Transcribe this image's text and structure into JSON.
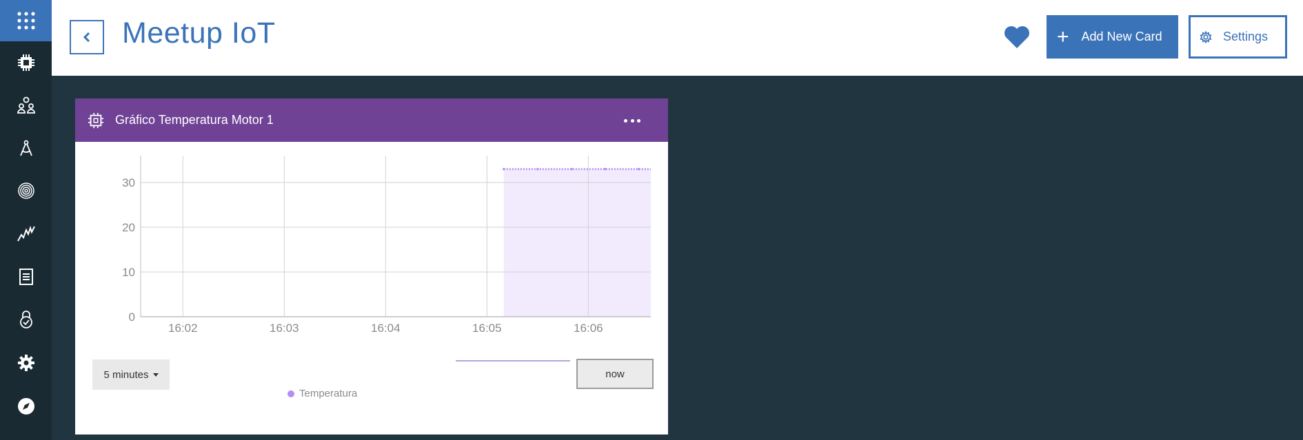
{
  "header": {
    "title": "Meetup IoT",
    "add_card_label": "Add New Card",
    "settings_label": "Settings"
  },
  "rail": {
    "items": [
      "apps-icon",
      "chip-icon",
      "members-icon",
      "compass-draw-icon",
      "fingerprint-icon",
      "analytics-icon",
      "document-icon",
      "security-icon",
      "gear-icon",
      "explore-icon"
    ]
  },
  "card": {
    "title": "Gráfico Temperatura Motor 1",
    "range_label": "5 minutes",
    "now_label": "now"
  },
  "colors": {
    "accent": "#3b73b9",
    "card_header": "#6f4296",
    "series": "#b48ef0",
    "background": "#213540"
  },
  "chart_data": {
    "type": "area",
    "title": "",
    "xlabel": "",
    "ylabel": "",
    "x_ticks": [
      "16:02",
      "16:03",
      "16:04",
      "16:05",
      "16:06"
    ],
    "y_ticks": [
      0,
      10,
      20,
      30
    ],
    "ylim": [
      0,
      36
    ],
    "x": [
      "16:05:10",
      "16:05:30",
      "16:05:50",
      "16:06:10",
      "16:06:30"
    ],
    "series": [
      {
        "name": "Temperatura",
        "values": [
          33,
          33,
          33,
          33,
          33
        ],
        "color": "#b48ef0"
      }
    ],
    "legend": "bottom",
    "grid": true
  }
}
